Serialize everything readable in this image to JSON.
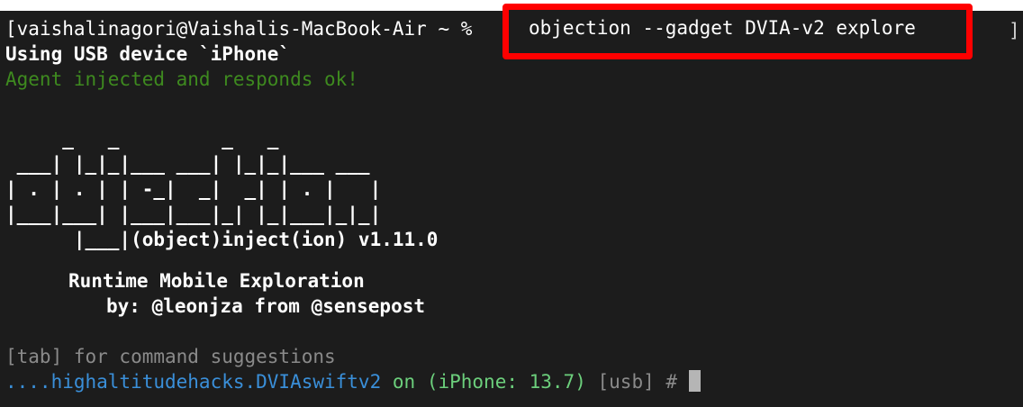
{
  "terminal": {
    "prompt": "vaishalinagori@Vaishalis-MacBook-Air ~ %",
    "command": "objection --gadget DVIA-v2 explore",
    "usb_line": "Using USB device `iPhone`",
    "agent_line": "Agent injected and responds ok!",
    "ascii_art": "     _   _         _   _\n ___| |_|_|___ ___| |_|_|___ ___\n| . | . | | -_|  _|  _| | . |   |\n|___|___| |___|___|_| |_|___|_|_|\n      |___|(object)inject(ion) v1.11.0",
    "tagline": "Runtime Mobile Exploration",
    "byline": "by: @leonjza from @sensepost",
    "tab_hint": "[tab] for command suggestions",
    "app_prompt_app": "....highaltitudehacks.DVIAswiftv2",
    "app_prompt_on": "on",
    "app_prompt_device": "(iPhone: 13.7)",
    "app_prompt_transport": "[usb]",
    "app_prompt_hash": "#",
    "right_bracket": "]"
  },
  "colors": {
    "background": "#1c1c1c",
    "green_text": "#3e8a1f",
    "app_blue": "#3a8fd9",
    "on_green": "#6ccf7c",
    "highlight_red": "#ff0000"
  }
}
